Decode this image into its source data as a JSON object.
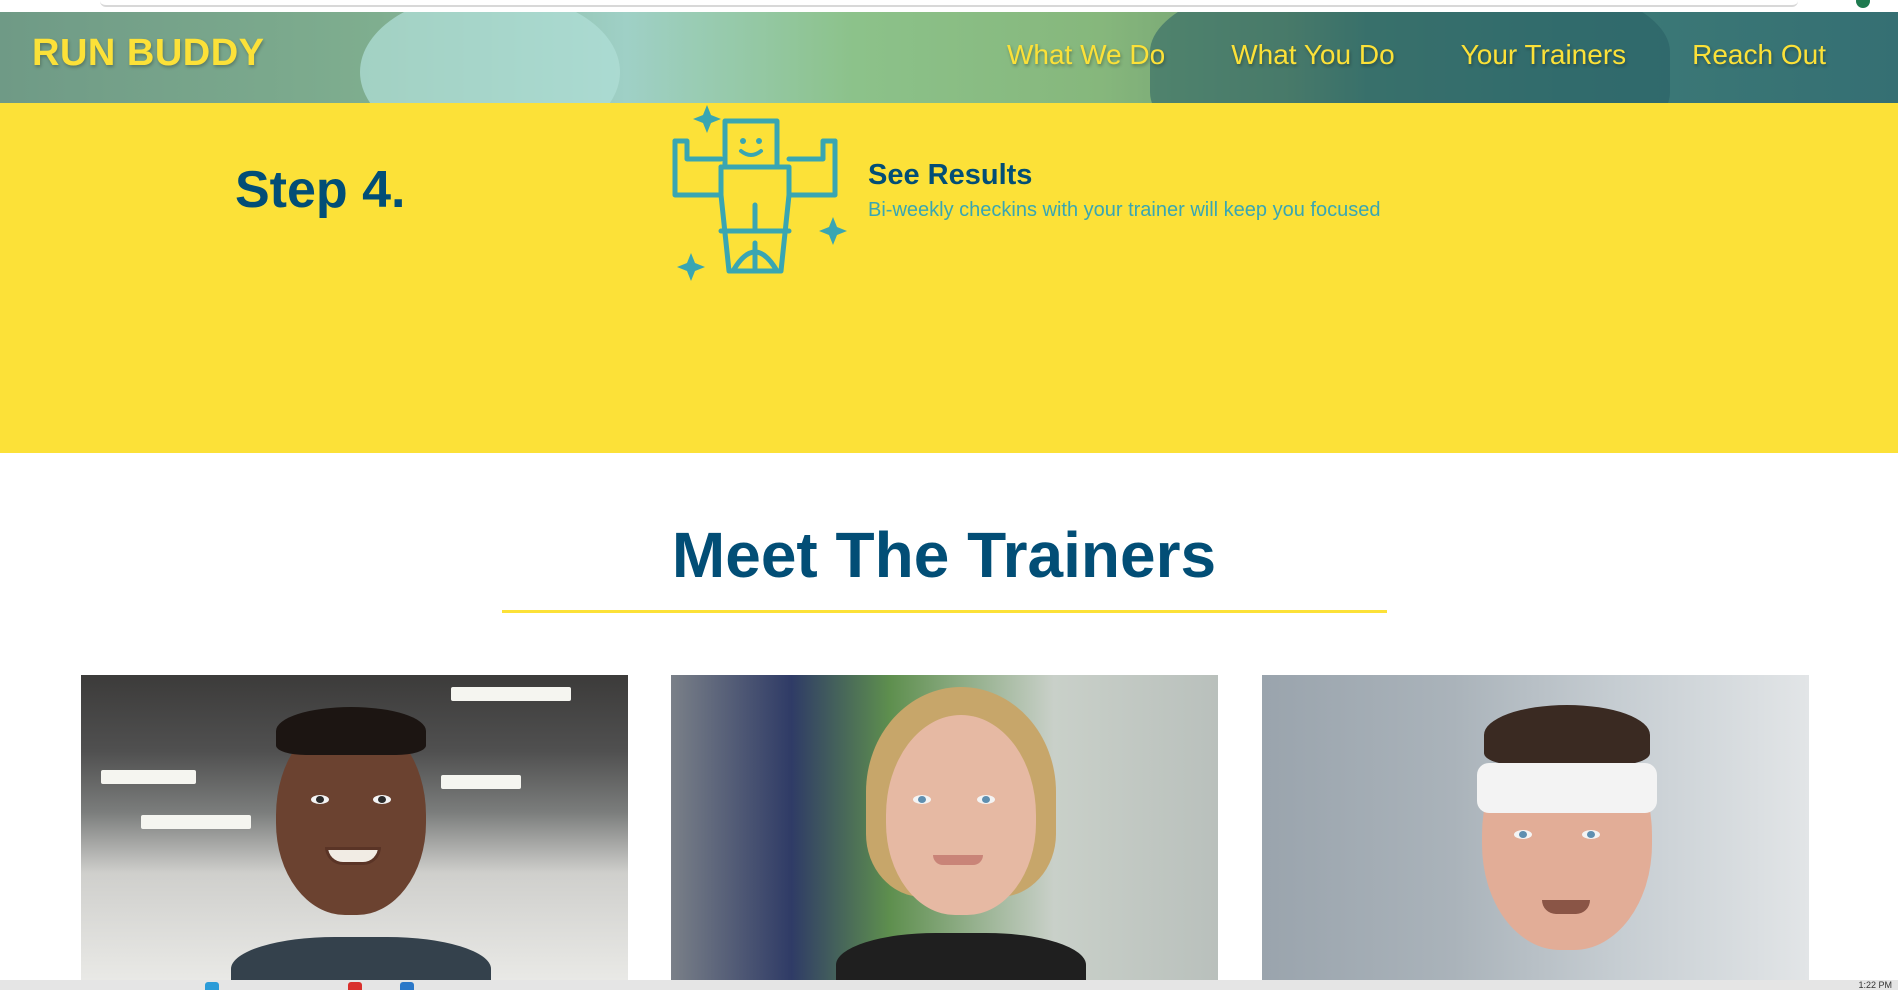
{
  "header": {
    "brand": "RUN BUDDY",
    "nav": [
      "What We Do",
      "What You Do",
      "Your Trainers",
      "Reach Out"
    ]
  },
  "step": {
    "number": "Step 4.",
    "icon": "muscle-robot-icon",
    "title": "See Results",
    "description": "Bi-weekly checkins with your trainer will keep you focused"
  },
  "trainers": {
    "title": "Meet The Trainers",
    "photos": [
      "trainer-photo-1",
      "trainer-photo-2",
      "trainer-photo-3"
    ]
  },
  "taskbar": {
    "clock": "1:22 PM"
  },
  "colors": {
    "yellow": "#fce138",
    "navy": "#024e76",
    "teal": "#39a6b2"
  }
}
